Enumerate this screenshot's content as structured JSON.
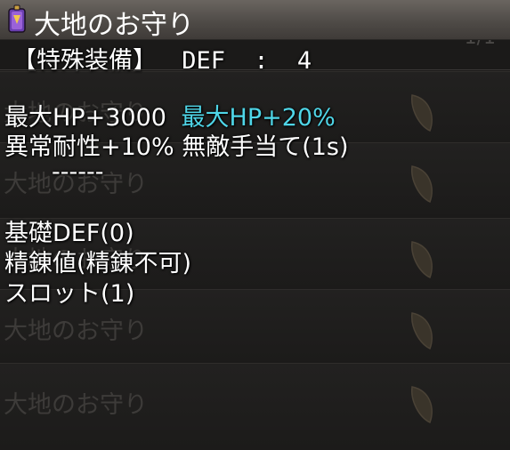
{
  "window": {
    "title": "大地のお守り",
    "page_indicator": "1/1"
  },
  "item": {
    "equip_label": "【特殊装備】",
    "stat_label": "DEF",
    "stat_sep": ":",
    "stat_value": "4",
    "effect1_base": "最大HP+3000",
    "effect1_bonus": "最大HP+20%",
    "effect2": "異常耐性+10% 無敵手当て(1s)",
    "separator": "------",
    "base_def": "基礎DEF(0)",
    "refine": "精錬値(精錬不可)",
    "slot": "スロット(1)"
  },
  "list": {
    "items": [
      {
        "name": "大地のお守り"
      },
      {
        "name": "大地のお守り"
      },
      {
        "name": "大地のお守り"
      },
      {
        "name": "大地のお守り"
      },
      {
        "name": "大地のお守り"
      }
    ]
  },
  "colors": {
    "bonus": "#4fd6e8",
    "text": "#ffffff",
    "ghost": "#3d3b39"
  }
}
